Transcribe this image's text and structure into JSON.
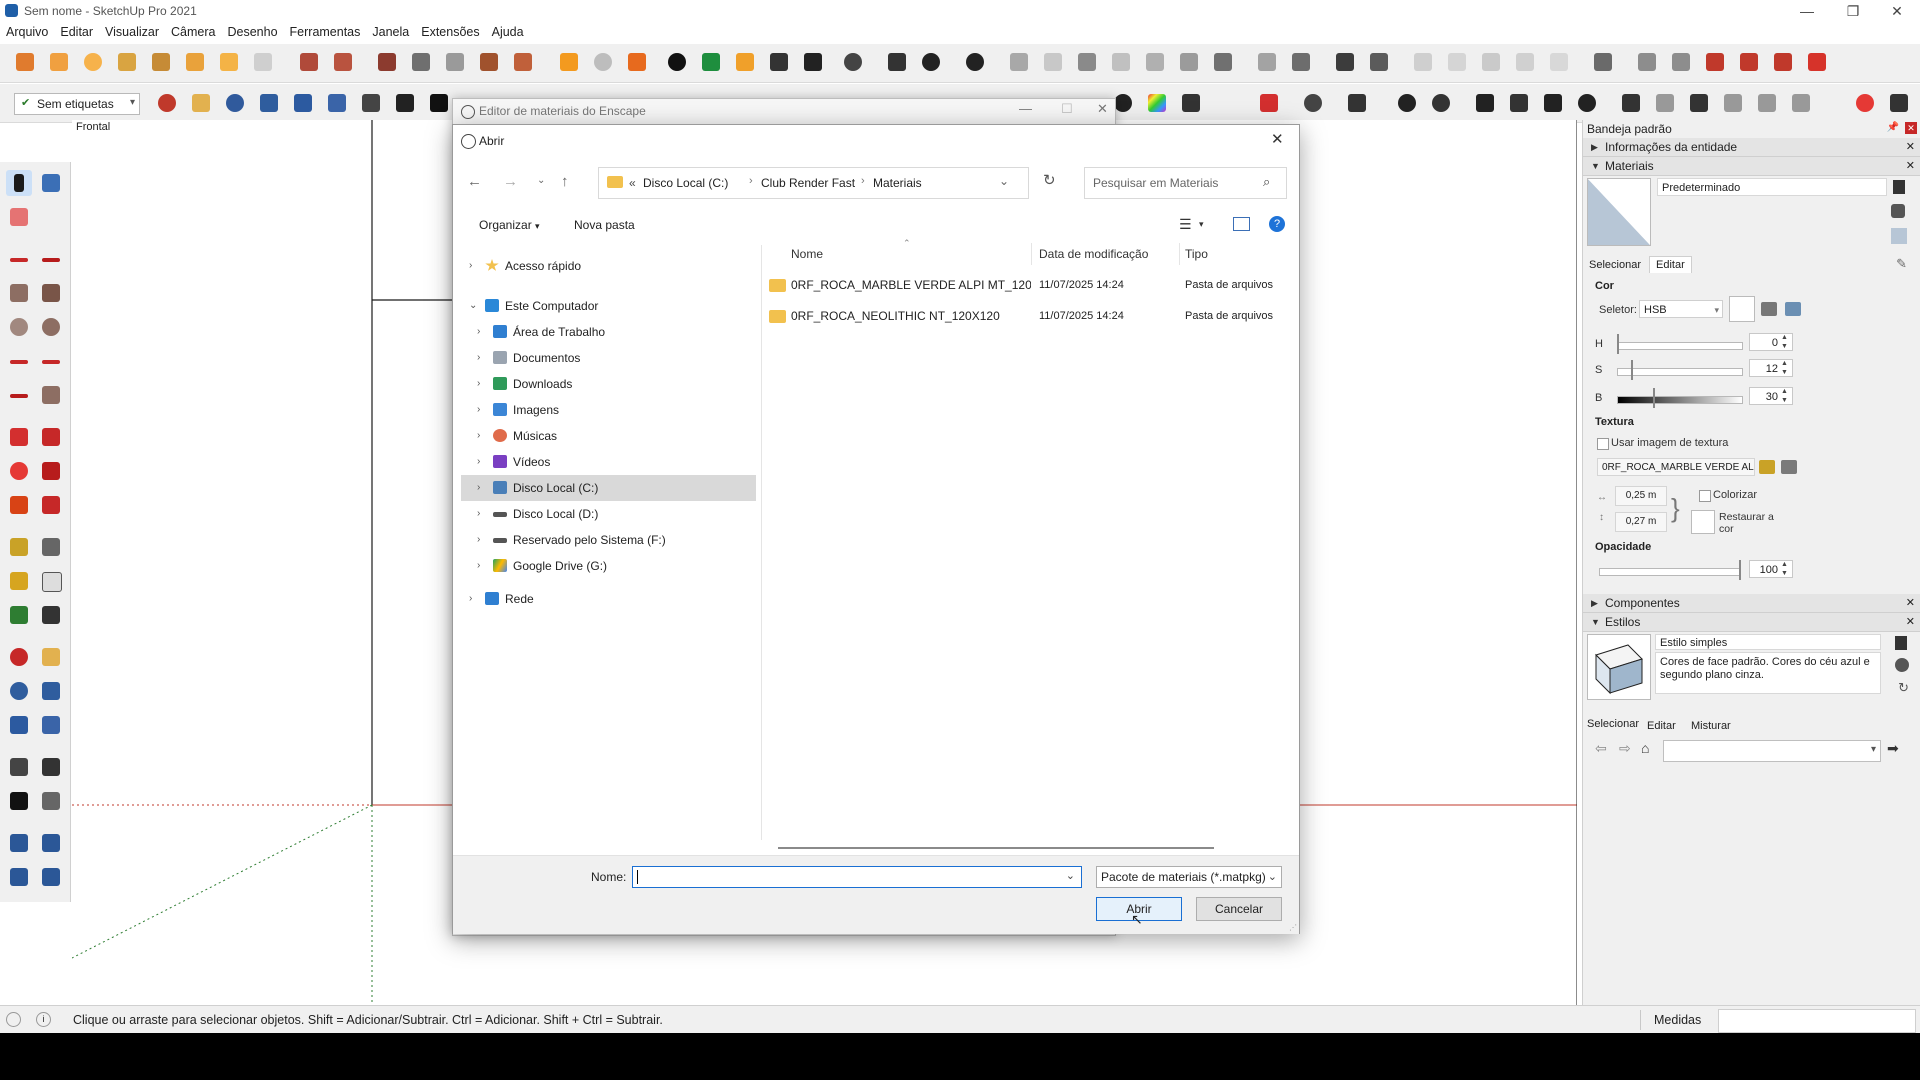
{
  "window": {
    "title": "Sem nome - SketchUp Pro 2021",
    "min": "—",
    "max": "❐",
    "close": "✕"
  },
  "menu": [
    "Arquivo",
    "Editar",
    "Visualizar",
    "Câmera",
    "Desenho",
    "Ferramentas",
    "Janela",
    "Extensões",
    "Ajuda"
  ],
  "toolbar": {
    "tags_label": "Sem etiquetas"
  },
  "canvas": {
    "view_label": "Frontal"
  },
  "enscape": {
    "title": "Editor de materiais do Enscape"
  },
  "dialog": {
    "title": "Abrir",
    "breadcrumb": [
      "«",
      "Disco Local (C:)",
      "Club Render Fast",
      "Materiais"
    ],
    "search_placeholder": "Pesquisar em Materiais",
    "organize": "Organizar",
    "new_folder": "Nova pasta",
    "tree": {
      "quick": "Acesso rápido",
      "pc": "Este Computador",
      "children": [
        "Área de Trabalho",
        "Documentos",
        "Downloads",
        "Imagens",
        "Músicas",
        "Vídeos",
        "Disco Local (C:)",
        "Disco Local (D:)",
        "Reservado pelo Sistema (F:)",
        "Google Drive (G:)"
      ],
      "network": "Rede"
    },
    "columns": {
      "name": "Nome",
      "date": "Data de modificação",
      "type": "Tipo"
    },
    "files": [
      {
        "name": "0RF_ROCA_MARBLE VERDE ALPI MT_120...",
        "date": "11/07/2025 14:24",
        "type": "Pasta de arquivos"
      },
      {
        "name": "0RF_ROCA_NEOLITHIC NT_120X120",
        "date": "11/07/2025 14:24",
        "type": "Pasta de arquivos"
      }
    ],
    "name_label": "Nome:",
    "name_value": "",
    "filter": "Pacote de materiais  (*.matpkg)",
    "open": "Abrir",
    "cancel": "Cancelar"
  },
  "tray": {
    "title": "Bandeja padrão",
    "entity": "Informações da entidade",
    "materials": "Materiais",
    "material_name": "Predeterminado",
    "tabs": [
      "Selecionar",
      "Editar"
    ],
    "color": "Cor",
    "picker_label": "Seletor:",
    "picker_value": "HSB",
    "h_label": "H",
    "h": "0",
    "s_label": "S",
    "s": "12",
    "b_label": "B",
    "b": "30",
    "texture": "Textura",
    "use_texture": "Usar imagem de textura",
    "texture_name": "0RF_ROCA_MARBLE VERDE AL",
    "width": "0,25 m",
    "height": "0,27 m",
    "colorize": "Colorizar",
    "restore": "Restaurar a cor",
    "opacity": "Opacidade",
    "opacity_value": "100",
    "components": "Componentes",
    "styles": "Estilos",
    "style_name": "Estilo simples",
    "style_desc": "Cores de face padrão. Cores do céu azul e segundo plano cinza.",
    "style_tabs": [
      "Selecionar",
      "Editar",
      "Misturar"
    ]
  },
  "status": {
    "hint": "Clique ou arraste para selecionar objetos. Shift = Adicionar/Subtrair. Ctrl = Adicionar. Shift + Ctrl = Subtrair.",
    "measures": "Medidas"
  }
}
